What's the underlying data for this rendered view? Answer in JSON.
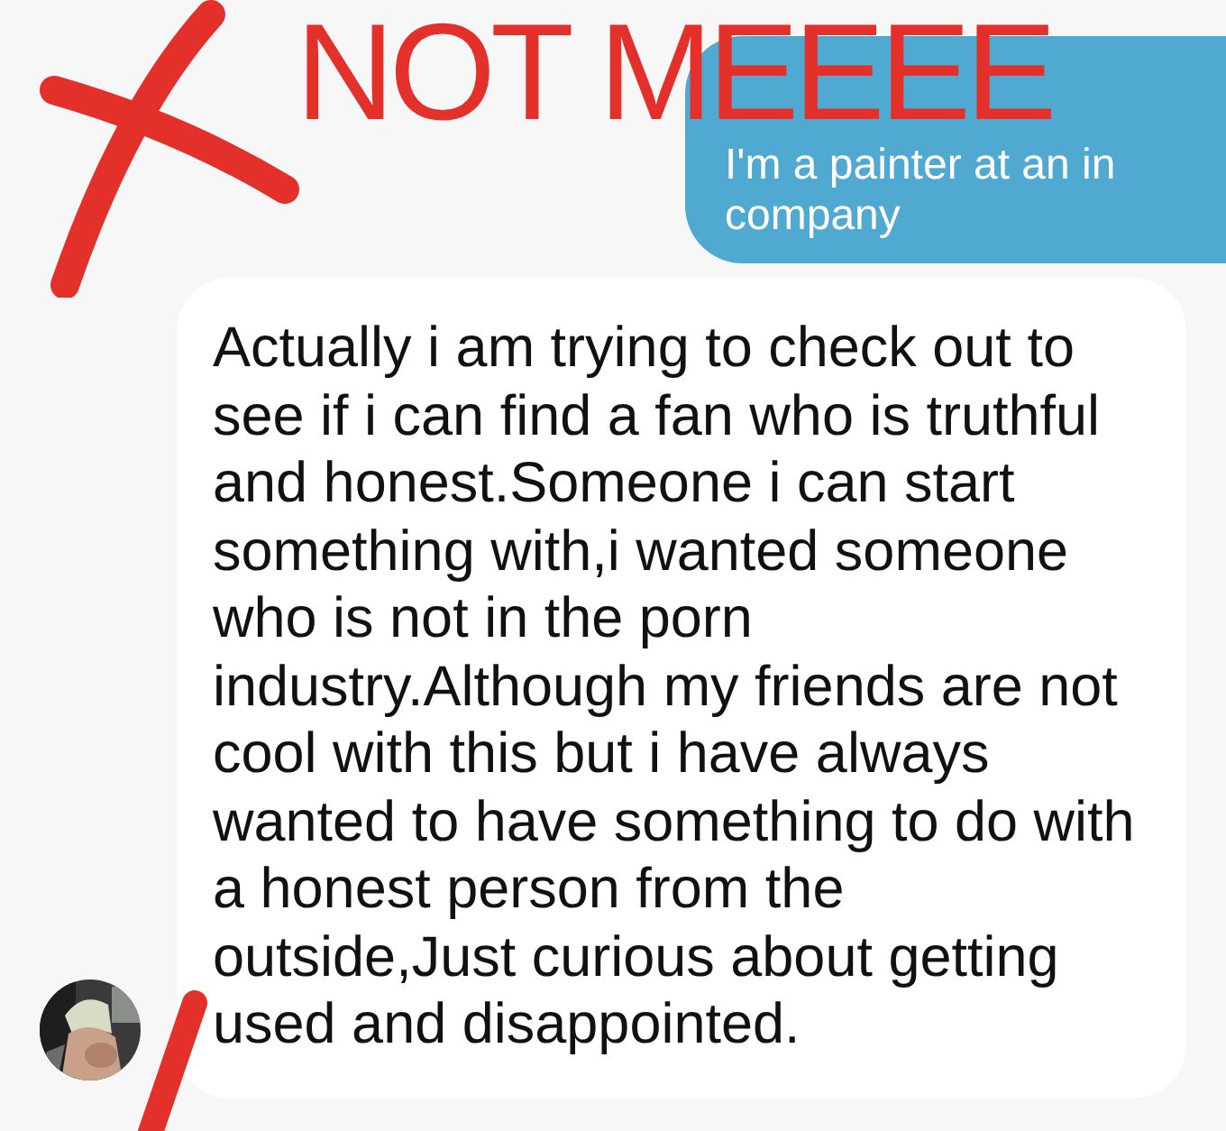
{
  "annotation": {
    "text": "NOT MEEEE"
  },
  "messages": [
    {
      "kind": "sent",
      "lines": [
        "I'm a painter at an in",
        "company"
      ]
    },
    {
      "kind": "received",
      "text": "Actually i am trying to check out to see if i can find a fan who is truthful and honest.Someone i can start something with,i wanted someone who is not in the porn industry.Although my friends are not cool with this but i have always wanted to have something to do with a honest person from the outside,Just curious about getting used and disappointed."
    }
  ]
}
